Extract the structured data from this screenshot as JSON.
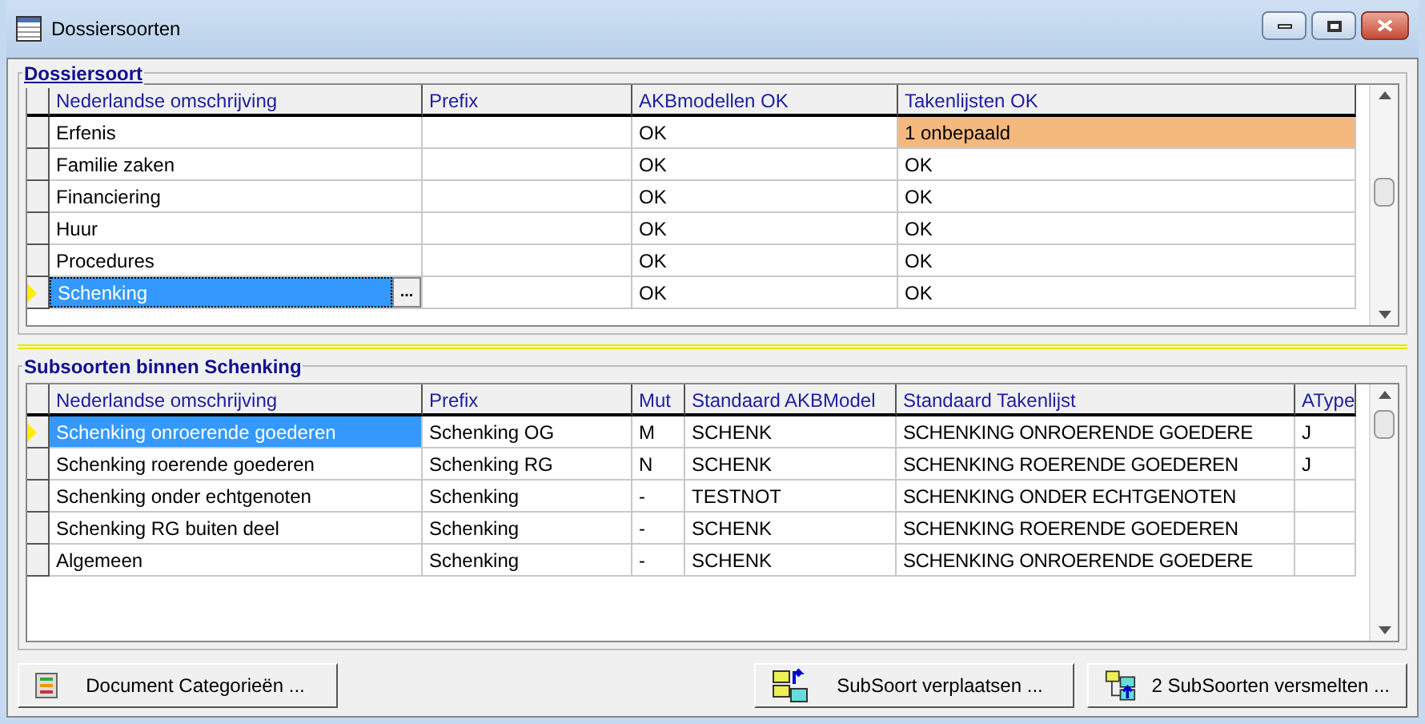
{
  "window": {
    "title": "Dossiersoorten"
  },
  "dossiersoort": {
    "title": "Dossiersoort",
    "columns": [
      "Nederlandse omschrijving",
      "Prefix",
      "AKBmodellen OK",
      "Takenlijsten OK"
    ],
    "edit_button": "...",
    "rows": [
      {
        "name": "Erfenis",
        "prefix": "",
        "akb": "OK",
        "taken": "1 onbepaald",
        "taken_warning": true,
        "selected": false
      },
      {
        "name": "Familie zaken",
        "prefix": "",
        "akb": "OK",
        "taken": "OK",
        "taken_warning": false,
        "selected": false
      },
      {
        "name": "Financiering",
        "prefix": "",
        "akb": "OK",
        "taken": "OK",
        "taken_warning": false,
        "selected": false
      },
      {
        "name": "Huur",
        "prefix": "",
        "akb": "OK",
        "taken": "OK",
        "taken_warning": false,
        "selected": false
      },
      {
        "name": "Procedures",
        "prefix": "",
        "akb": "OK",
        "taken": "OK",
        "taken_warning": false,
        "selected": false
      },
      {
        "name": "Schenking",
        "prefix": "",
        "akb": "OK",
        "taken": "OK",
        "taken_warning": false,
        "selected": true
      }
    ]
  },
  "subsoorten": {
    "title": "Subsoorten binnen Schenking",
    "columns": [
      "Nederlandse omschrijving",
      "Prefix",
      "Mut",
      "Standaard AKBModel",
      "Standaard Takenlijst",
      "AType"
    ],
    "rows": [
      {
        "name": "Schenking onroerende goederen",
        "prefix": "Schenking OG",
        "mut": "M",
        "akb": "SCHENK",
        "taken": "SCHENKING ONROERENDE GOEDERE",
        "atype": "J",
        "selected": true
      },
      {
        "name": "Schenking roerende goederen",
        "prefix": "Schenking RG",
        "mut": "N",
        "akb": "SCHENK",
        "taken": "SCHENKING ROERENDE GOEDEREN",
        "atype": "J",
        "selected": false
      },
      {
        "name": "Schenking onder echtgenoten",
        "prefix": "Schenking",
        "mut": "-",
        "akb": "TESTNOT",
        "taken": "SCHENKING ONDER ECHTGENOTEN",
        "atype": "",
        "selected": false
      },
      {
        "name": "Schenking RG buiten deel",
        "prefix": "Schenking",
        "mut": "-",
        "akb": "SCHENK",
        "taken": "SCHENKING ROERENDE GOEDEREN",
        "atype": "",
        "selected": false
      },
      {
        "name": "Algemeen",
        "prefix": "Schenking",
        "mut": "-",
        "akb": "SCHENK",
        "taken": "SCHENKING ONROERENDE GOEDERE",
        "atype": "",
        "selected": false
      }
    ]
  },
  "buttons": [
    {
      "label": "Document Categorieën ...",
      "kind": "categories"
    },
    {
      "label": "SubSoort verplaatsen ...",
      "kind": "move"
    },
    {
      "label": "2 SubSoorten versmelten ...",
      "kind": "merge"
    }
  ]
}
